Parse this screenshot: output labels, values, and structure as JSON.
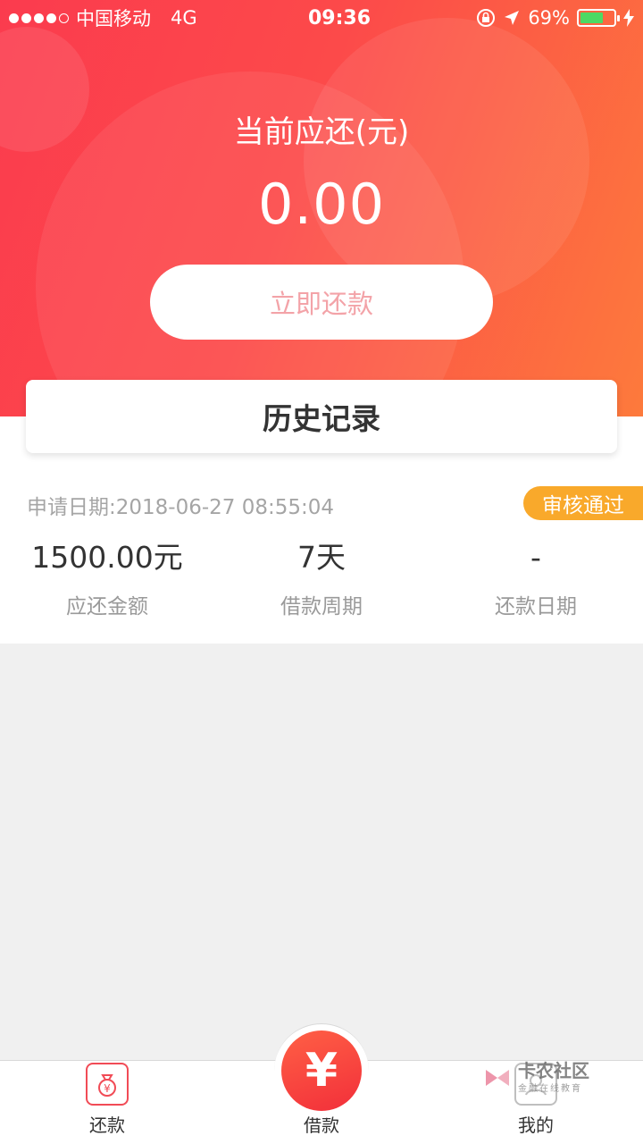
{
  "status_bar": {
    "carrier": "中国移动",
    "network": "4G",
    "time": "09:36",
    "battery_percent": "69%",
    "battery_level": 0.69
  },
  "hero": {
    "due_label": "当前应还(元)",
    "due_amount": "0.00",
    "repay_button": "立即还款"
  },
  "history": {
    "title": "历史记录"
  },
  "record": {
    "apply_date": "申请日期:2018-06-27 08:55:04",
    "status": "审核通过",
    "stats": [
      {
        "value": "1500.00元",
        "label": "应还金额"
      },
      {
        "value": "7天",
        "label": "借款周期"
      },
      {
        "value": "-",
        "label": "还款日期"
      }
    ]
  },
  "tabbar": {
    "items": [
      {
        "label": "还款",
        "icon": "money-bag-icon"
      },
      {
        "label": "借款",
        "icon": "yen-icon",
        "glyph": "¥"
      },
      {
        "label": "我的",
        "icon": "user-icon"
      }
    ]
  },
  "watermark": {
    "title": "卡农社区",
    "subtitle": "金融在线教育"
  },
  "colors": {
    "accent_red": "#fc4a4a",
    "accent_orange": "#fd7a3c",
    "badge_orange": "#f9a92b",
    "button_text_pink": "#f3a3a8"
  }
}
